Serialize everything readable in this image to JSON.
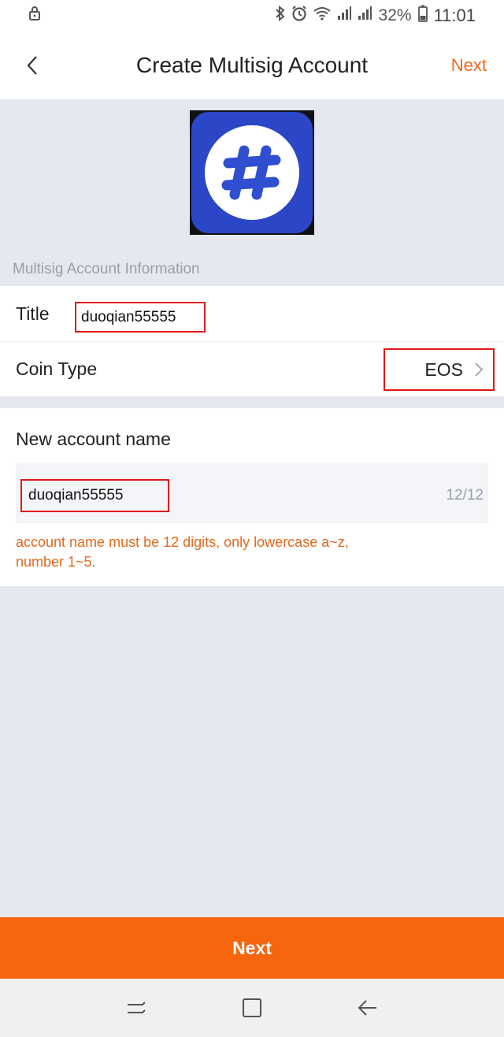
{
  "status_bar": {
    "battery_percent": "32%",
    "time": "11:01",
    "icons": [
      "lock-icon",
      "bluetooth-icon",
      "alarm-icon",
      "wifi-icon",
      "signal-icon",
      "battery-icon"
    ]
  },
  "header": {
    "title": "Create Multisig Account",
    "next_label": "Next",
    "back_icon": "chevron-left-icon"
  },
  "logo": {
    "icon": "hash-logo-icon",
    "color": "#2b47c8"
  },
  "info_section": {
    "label": "Multisig Account Information",
    "title_label": "Title",
    "title_value": "duoqian55555",
    "coin_type_label": "Coin Type",
    "coin_type_value": "EOS"
  },
  "account_name": {
    "heading": "New account name",
    "value": "duoqian55555",
    "counter": "12/12",
    "hint": "account name must be 12 digits, only lowercase a~z, number 1~5."
  },
  "footer": {
    "next_button": "Next"
  },
  "colors": {
    "accent": "#f5660f",
    "highlight_border": "#e01818",
    "background": "#e6e8f0"
  }
}
